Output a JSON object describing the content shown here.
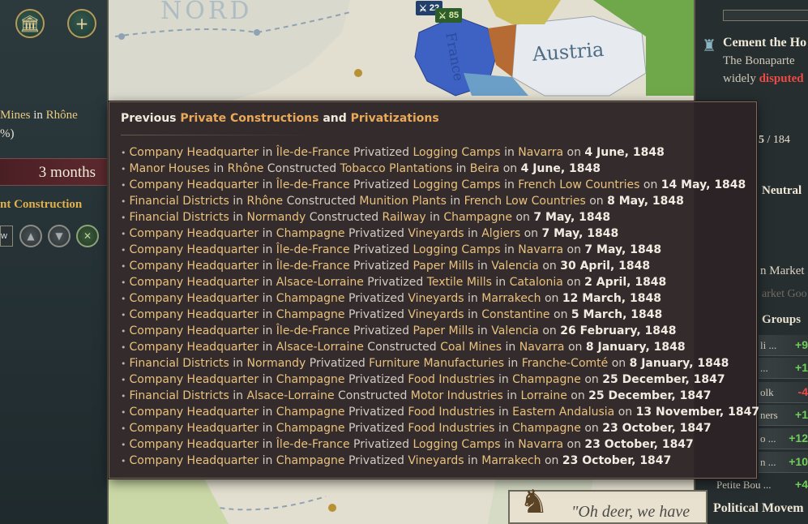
{
  "map": {
    "label_nord": "NORD",
    "label_austria": "Austria",
    "label_france": "France",
    "army_blue": "22",
    "army_green": "85"
  },
  "left_panel": {
    "mines_prefix": "Mines",
    "mines_in": "in",
    "mines_state": "Rhône",
    "pct_suffix": "%)",
    "duration": "3 months",
    "construction_label": "nt Construction",
    "select_text": "w"
  },
  "right_panel": {
    "event_title": "Cement the Ho",
    "event_line1": "The Bonaparte",
    "event_line2_prefix": "widely",
    "event_line2_highlight": "disputed",
    "count_value": "5",
    "count_total": "/ 184",
    "neutral_label": "Neutral",
    "market_label": "n Market",
    "market_goods_label": "arket Goo",
    "groups_label": "Groups",
    "interest_groups": [
      {
        "name": "li ...",
        "value": "+9",
        "positive": true
      },
      {
        "name": "...",
        "value": "+1",
        "positive": true
      },
      {
        "name": "olk",
        "value": "-4",
        "positive": false
      },
      {
        "name": "ners",
        "value": "+1",
        "positive": true
      },
      {
        "name": "o ...",
        "value": "+12",
        "positive": true
      },
      {
        "name": "n ...",
        "value": "+10",
        "positive": true
      }
    ],
    "petite_name": "Petite Bou ...",
    "petite_value": "+4",
    "political_label": "Political Movem",
    "quote_text": "\"Oh deer, we have"
  },
  "tooltip": {
    "title_prefix": "Previous",
    "title_hl1": "Private Constructions",
    "title_and": "and",
    "title_hl2": "Privatizations",
    "entries": [
      {
        "actor": "Company Headquarter",
        "actor_state": "Île-de-France",
        "verb": "Privatized",
        "building": "Logging Camps",
        "state": "Navarra",
        "date": "4 June, 1848"
      },
      {
        "actor": "Manor Houses",
        "actor_state": "Rhône",
        "verb": "Constructed",
        "building": "Tobacco Plantations",
        "state": "Beira",
        "date": "4 June, 1848"
      },
      {
        "actor": "Company Headquarter",
        "actor_state": "Île-de-France",
        "verb": "Privatized",
        "building": "Logging Camps",
        "state": "French Low Countries",
        "date": "14 May, 1848"
      },
      {
        "actor": "Financial Districts",
        "actor_state": "Rhône",
        "verb": "Constructed",
        "building": "Munition Plants",
        "state": "French Low Countries",
        "date": "8 May, 1848"
      },
      {
        "actor": "Financial Districts",
        "actor_state": "Normandy",
        "verb": "Constructed",
        "building": "Railway",
        "state": "Champagne",
        "date": "7 May, 1848"
      },
      {
        "actor": "Company Headquarter",
        "actor_state": "Champagne",
        "verb": "Privatized",
        "building": "Vineyards",
        "state": "Algiers",
        "date": "7 May, 1848"
      },
      {
        "actor": "Company Headquarter",
        "actor_state": "Île-de-France",
        "verb": "Privatized",
        "building": "Logging Camps",
        "state": "Navarra",
        "date": "7 May, 1848"
      },
      {
        "actor": "Company Headquarter",
        "actor_state": "Île-de-France",
        "verb": "Privatized",
        "building": "Paper Mills",
        "state": "Valencia",
        "date": "30 April, 1848"
      },
      {
        "actor": "Company Headquarter",
        "actor_state": "Alsace-Lorraine",
        "verb": "Privatized",
        "building": "Textile Mills",
        "state": "Catalonia",
        "date": "2 April, 1848"
      },
      {
        "actor": "Company Headquarter",
        "actor_state": "Champagne",
        "verb": "Privatized",
        "building": "Vineyards",
        "state": "Marrakech",
        "date": "12 March, 1848"
      },
      {
        "actor": "Company Headquarter",
        "actor_state": "Champagne",
        "verb": "Privatized",
        "building": "Vineyards",
        "state": "Constantine",
        "date": "5 March, 1848"
      },
      {
        "actor": "Company Headquarter",
        "actor_state": "Île-de-France",
        "verb": "Privatized",
        "building": "Paper Mills",
        "state": "Valencia",
        "date": "26 February, 1848"
      },
      {
        "actor": "Company Headquarter",
        "actor_state": "Alsace-Lorraine",
        "verb": "Constructed",
        "building": "Coal Mines",
        "state": "Navarra",
        "date": "8 January, 1848"
      },
      {
        "actor": "Financial Districts",
        "actor_state": "Normandy",
        "verb": "Privatized",
        "building": "Furniture Manufacturies",
        "state": "Franche-Comté",
        "date": "8 January, 1848"
      },
      {
        "actor": "Company Headquarter",
        "actor_state": "Champagne",
        "verb": "Privatized",
        "building": "Food Industries",
        "state": "Champagne",
        "date": "25 December, 1847"
      },
      {
        "actor": "Financial Districts",
        "actor_state": "Alsace-Lorraine",
        "verb": "Constructed",
        "building": "Motor Industries",
        "state": "Lorraine",
        "date": "25 December, 1847"
      },
      {
        "actor": "Company Headquarter",
        "actor_state": "Champagne",
        "verb": "Privatized",
        "building": "Food Industries",
        "state": "Eastern Andalusia",
        "date": "13 November, 1847"
      },
      {
        "actor": "Company Headquarter",
        "actor_state": "Champagne",
        "verb": "Privatized",
        "building": "Food Industries",
        "state": "Champagne",
        "date": "23 October, 1847"
      },
      {
        "actor": "Company Headquarter",
        "actor_state": "Île-de-France",
        "verb": "Privatized",
        "building": "Logging Camps",
        "state": "Navarra",
        "date": "23 October, 1847"
      },
      {
        "actor": "Company Headquarter",
        "actor_state": "Champagne",
        "verb": "Privatized",
        "building": "Vineyards",
        "state": "Marrakech",
        "date": "23 October, 1847"
      }
    ],
    "word_in": "in",
    "word_on": "on"
  },
  "icons": {
    "building": "building-columns-icon",
    "add": "plus-icon",
    "up": "arrow-up-icon",
    "down": "arrow-down-icon",
    "cancel": "cancel-icon"
  },
  "colors": {
    "highlight": "#e8c27e",
    "title_highlight": "#e9a95a",
    "positive": "#6fcf5a",
    "negative": "#ee4a45"
  }
}
